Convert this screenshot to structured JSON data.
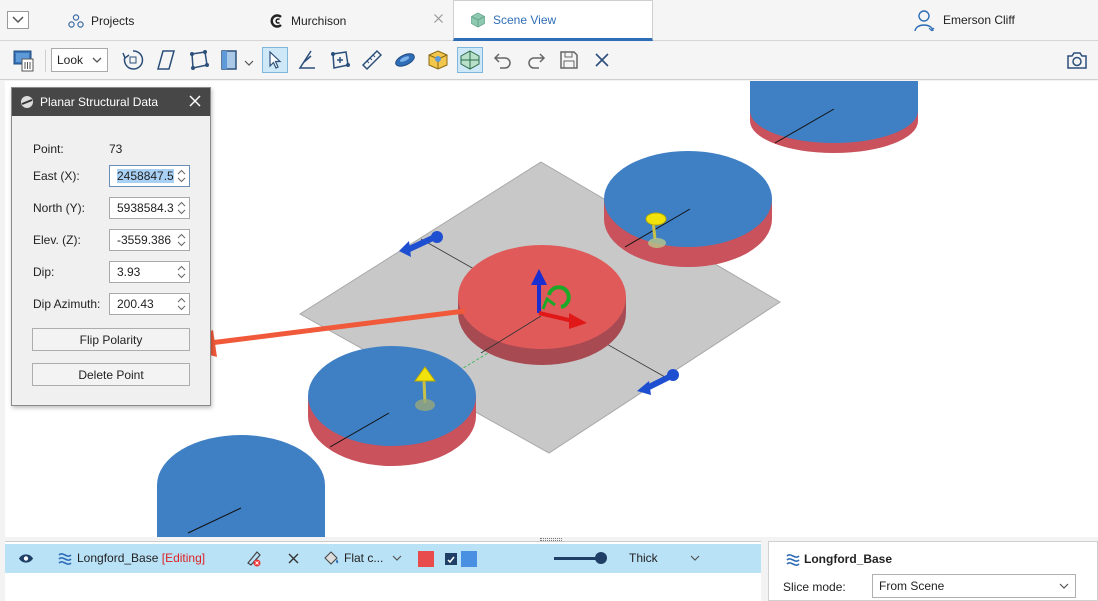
{
  "tabs": {
    "projects": "Projects",
    "murchison": "Murchison",
    "scene_view": "Scene View",
    "user": "Emerson Cliff"
  },
  "toolbar": {
    "look_label": "Look"
  },
  "dialog": {
    "title": "Planar Structural Data",
    "point_label": "Point:",
    "point_value": "73",
    "east_label": "East (X):",
    "east_value": "2458847.5",
    "north_label": "North (Y):",
    "north_value": "5938584.3",
    "elev_label": "Elev. (Z):",
    "elev_value": "-3559.386",
    "dip_label": "Dip:",
    "dip_value": "3.93",
    "dip_azimuth_label": "Dip Azimuth:",
    "dip_azimuth_value": "200.43",
    "flip_polarity_label": "Flip Polarity",
    "delete_point_label": "Delete Point"
  },
  "object_row": {
    "name": "Longford_Base",
    "editing": "[Editing]",
    "shading": "Flat c...",
    "thickness": "Thick"
  },
  "properties": {
    "title": "Longford_Base",
    "slice_mode_label": "Slice mode:",
    "slice_mode_value": "From Scene"
  },
  "colors": {
    "accent": "#2f6db6",
    "disc_blue": "#3f7fc4",
    "disc_red": "#e05a5a",
    "arrow_red": "#f05a3a",
    "row_highlight": "#b9e2f7",
    "editing_red": "#dd2222",
    "swatch_red": "#e84c4c",
    "swatch_blue": "#4a90e2"
  },
  "icons": {
    "dropdown_tab": "chevron-down-icon",
    "projects": "projects-icon",
    "murchison": "murchison-logo-icon",
    "scene": "scene-cube-icon",
    "user": "user-icon",
    "camera": "camera-icon"
  }
}
